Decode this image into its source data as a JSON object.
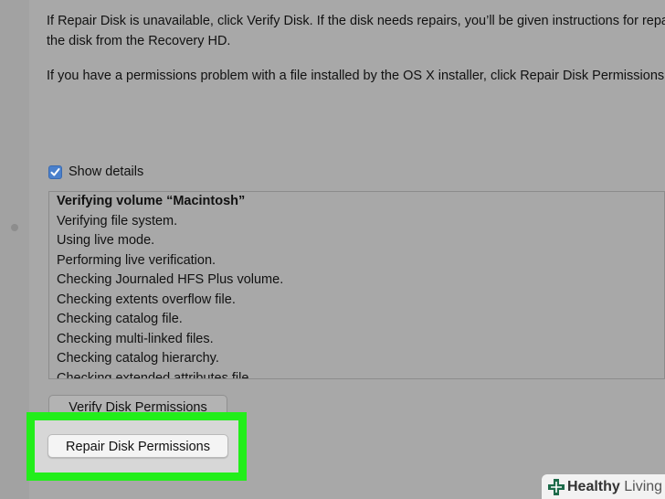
{
  "instructions": {
    "para1_line1": "If Repair Disk is unavailable, click Verify Disk. If the disk needs repairs, you’ll be given instructions for repairing",
    "para1_line2": "the disk from the Recovery HD.",
    "para2": "If you have a permissions problem with a file installed by the OS X installer, click Repair Disk Permissions."
  },
  "show_details": {
    "label": "Show details",
    "checked": true
  },
  "log": {
    "lines": [
      "Verifying volume “Macintosh”",
      "Verifying file system.",
      "Using live mode.",
      "Performing live verification.",
      "Checking Journaled HFS Plus volume.",
      "Checking extents overflow file.",
      "Checking catalog file.",
      "Checking multi-linked files.",
      "Checking catalog hierarchy.",
      "Checking extended attributes file."
    ]
  },
  "buttons": {
    "verify_permissions": "Verify Disk Permissions",
    "repair_permissions": "Repair Disk Permissions"
  },
  "colors": {
    "highlight": "#22ee1a",
    "checkbox": "#4a80cc",
    "watermark_plus": "#1d6b4a"
  },
  "watermark": {
    "icon": "plus-cross-icon",
    "brand_bold": "Healthy",
    "brand_light": " Living"
  }
}
